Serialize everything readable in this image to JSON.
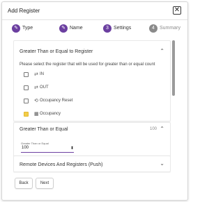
{
  "dialog": {
    "title": "Add Register",
    "close_glyph": "✕"
  },
  "stepper": {
    "steps": [
      {
        "label": "Type",
        "state": "done",
        "glyph": "✎"
      },
      {
        "label": "Name",
        "state": "done",
        "glyph": "✎"
      },
      {
        "label": "Settings",
        "state": "active",
        "glyph": "3"
      },
      {
        "label": "Summary",
        "state": "todo",
        "glyph": "4"
      }
    ]
  },
  "panels": {
    "greater_than_or_equal_register": {
      "title": "Greater Than or Equal to Register",
      "description": "Please select the register that will be used for greater than or equal count",
      "options": [
        {
          "icon": "arrows-icon",
          "glyph": "⇄",
          "label": "IN",
          "checked": false
        },
        {
          "icon": "arrows-icon",
          "glyph": "⇄",
          "label": "OUT",
          "checked": false
        },
        {
          "icon": "reset-icon",
          "glyph": "⟲",
          "label": "Occupancy Reset",
          "checked": false
        },
        {
          "icon": "grid-icon",
          "glyph": "▦",
          "label": "Occupancy",
          "checked": true
        }
      ]
    },
    "greater_than_or_equal": {
      "title": "Greater Than or Equal",
      "value_display": "100",
      "field_label": "Greater Than or Equal",
      "field_value": "100",
      "spinner_glyph": "⬍"
    },
    "remote_devices": {
      "title": "Remote Devices And Registers (Push)"
    }
  },
  "footer": {
    "back_label": "Back",
    "next_label": "Next"
  },
  "colors": {
    "accent": "#6b3fa0",
    "checkbox_checked": "#f2cd4a"
  }
}
